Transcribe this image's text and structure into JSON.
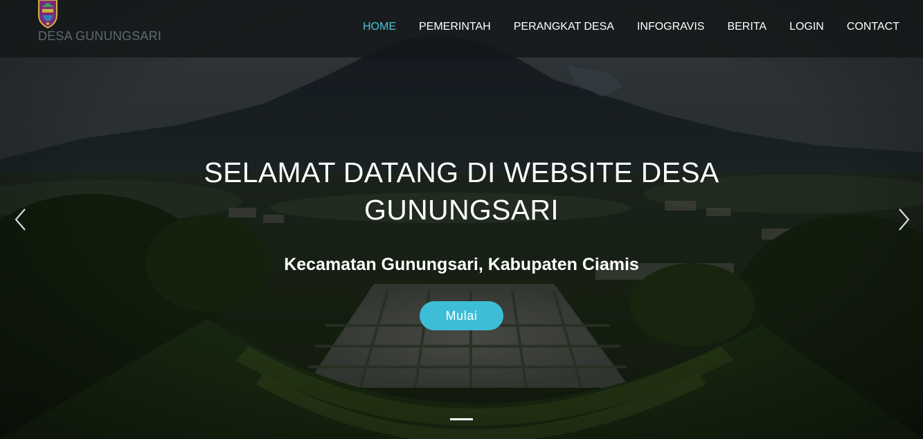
{
  "brand": {
    "name": "DESA GUNUNGSARI",
    "emblem_icon": "village-emblem-icon"
  },
  "nav": {
    "items": [
      {
        "label": "HOME",
        "active": true
      },
      {
        "label": "PEMERINTAH",
        "active": false
      },
      {
        "label": "PERANGKAT DESA",
        "active": false
      },
      {
        "label": "INFOGRAVIS",
        "active": false
      },
      {
        "label": "BERITA",
        "active": false
      },
      {
        "label": "LOGIN",
        "active": false
      },
      {
        "label": "CONTACT",
        "active": false
      }
    ]
  },
  "hero": {
    "title": "SELAMAT DATANG DI WEBSITE DESA GUNUNGSARI",
    "subtitle": "Kecamatan Gunungsari, Kabupaten Ciamis",
    "button_label": "Mulai",
    "prev_icon": "chevron-left-icon",
    "next_icon": "chevron-right-icon",
    "slide_count": 1,
    "active_slide": 1
  },
  "colors": {
    "accent": "#45c5dc",
    "button": "#3ebed6",
    "navbar": "#141618",
    "text": "#ffffff",
    "brand_text": "#5d6a70"
  }
}
